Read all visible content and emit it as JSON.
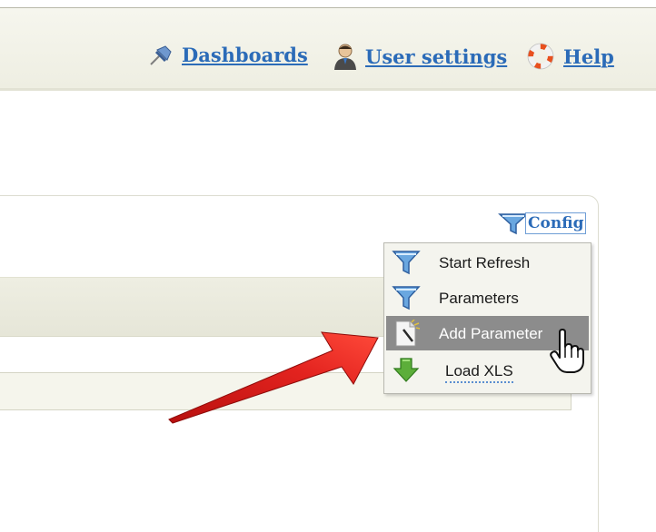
{
  "nav": {
    "dashboards": "Dashboards",
    "user_settings": "User settings",
    "help": "Help"
  },
  "config": {
    "label": "Config"
  },
  "menu": {
    "items": [
      {
        "label": "Start Refresh",
        "icon": "funnel-icon"
      },
      {
        "label": "Parameters",
        "icon": "funnel-icon"
      },
      {
        "label": "Add Parameter",
        "icon": "new-document-icon",
        "hovered": true
      },
      {
        "label": "Load XLS",
        "icon": "download-arrow-icon"
      }
    ]
  },
  "colors": {
    "link": "#2b6bb8",
    "menu_hover": "#8c8c8c",
    "annotation_arrow": "#e0201c"
  }
}
